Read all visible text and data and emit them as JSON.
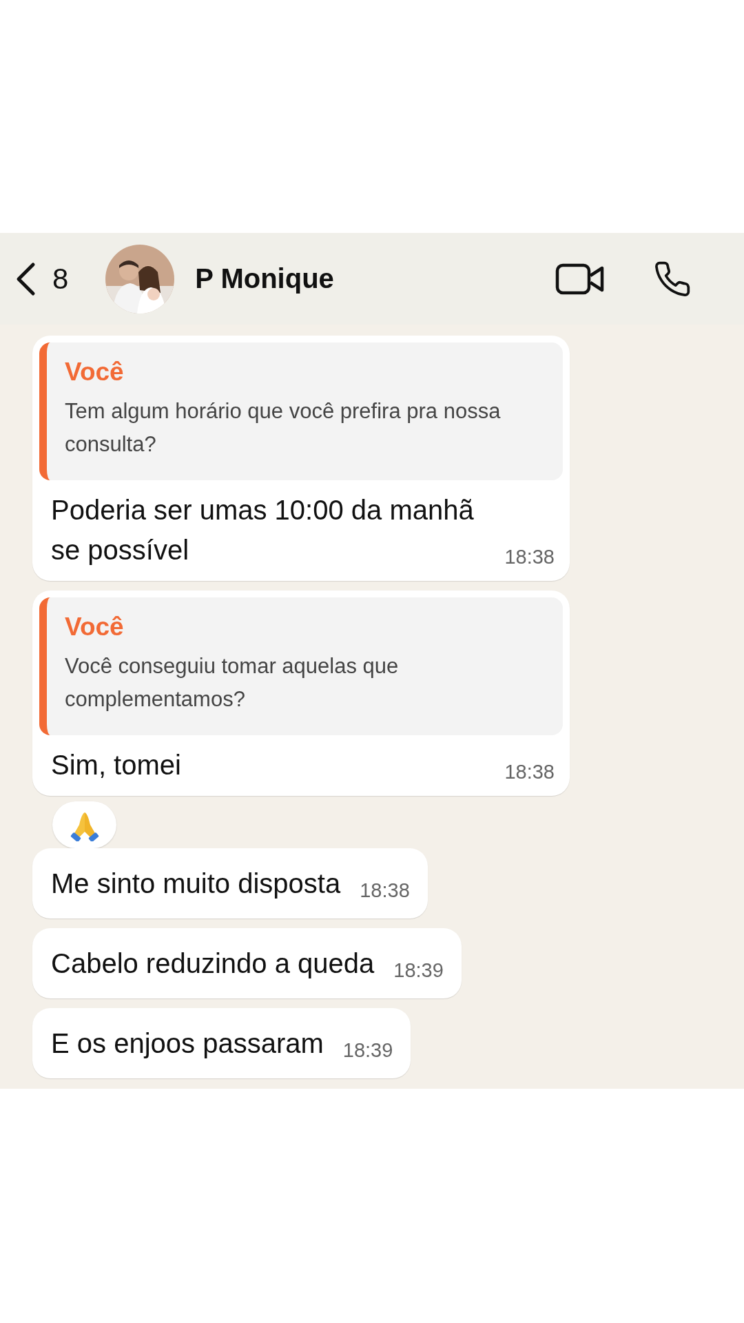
{
  "contact": {
    "back_count": "8",
    "name": "P Monique"
  },
  "messages": [
    {
      "kind": "reply",
      "quote": {
        "author": "Você",
        "text": "Tem algum horário que você prefira pra nossa consulta?"
      },
      "text": "Poderia ser umas 10:00 da manhã se possível",
      "time": "18:38"
    },
    {
      "kind": "reply",
      "quote": {
        "author": "Você",
        "text": "Você conseguiu tomar aquelas que complementamos?"
      },
      "text": "Sim, tomei",
      "time": "18:38",
      "reaction": {
        "kind": "pray"
      }
    },
    {
      "kind": "plain",
      "text": "Me sinto muito disposta",
      "time": "18:38"
    },
    {
      "kind": "plain",
      "text": "Cabelo reduzindo a queda",
      "time": "18:39"
    },
    {
      "kind": "plain",
      "text": "E os enjoos passaram",
      "time": "18:39"
    }
  ]
}
